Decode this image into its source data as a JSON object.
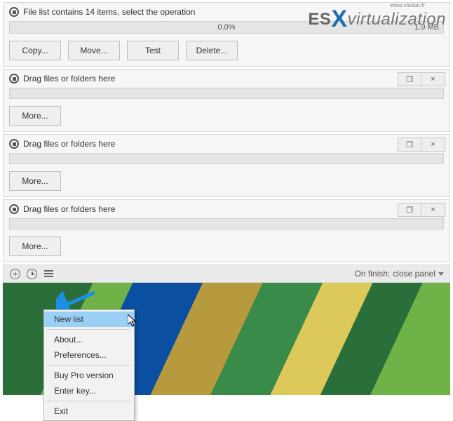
{
  "watermark": {
    "prefix": "ES",
    "x": "X",
    "suffix": "virtualization",
    "url": "www.vladan.fr"
  },
  "main_panel": {
    "status": "File list contains 14 items, select the operation",
    "progress_pct": "0.0%",
    "total_size": "1.9 MB",
    "buttons": {
      "copy": "Copy...",
      "move": "Move...",
      "test": "Test",
      "delete": "Delete..."
    }
  },
  "drop_panel": {
    "placeholder": "Drag files or folders here",
    "more": "More...",
    "duplicate_glyph": "❐",
    "close_glyph": "×"
  },
  "bottom_bar": {
    "on_finish_label": "On finish:",
    "on_finish_value": "close panel"
  },
  "menu": {
    "new_list": "New list",
    "about": "About...",
    "preferences": "Preferences...",
    "buy_pro": "Buy Pro version",
    "enter_key": "Enter key...",
    "exit": "Exit"
  }
}
